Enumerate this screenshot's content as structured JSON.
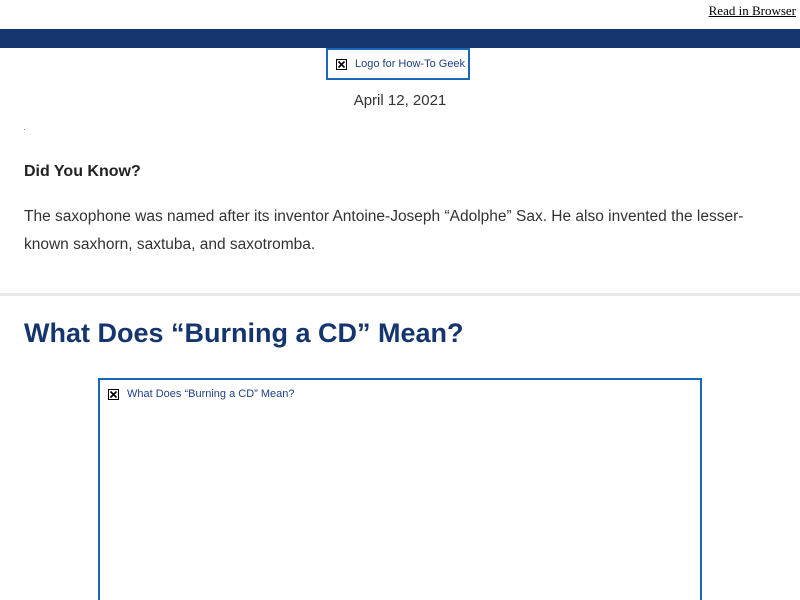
{
  "header": {
    "read_in_browser": "Read in Browser"
  },
  "logo": {
    "alt_text": "Logo for How-To Geek",
    "icon": "broken-image-icon"
  },
  "date": "April 12, 2021",
  "did_you_know": {
    "heading": "Did You Know?",
    "body": "The saxophone was named after its inventor Antoine-Joseph “Adolphe” Sax. He also invented the lesser-known saxhorn, saxtuba, and saxotromba."
  },
  "article": {
    "title": "What Does “Burning a CD” Mean?",
    "image_alt": "What Does “Burning a CD” Mean?",
    "image_icon": "broken-image-icon"
  },
  "colors": {
    "brand_navy": "#15356e",
    "link_blue": "#1b66b8",
    "divider": "#e8e8e8"
  }
}
